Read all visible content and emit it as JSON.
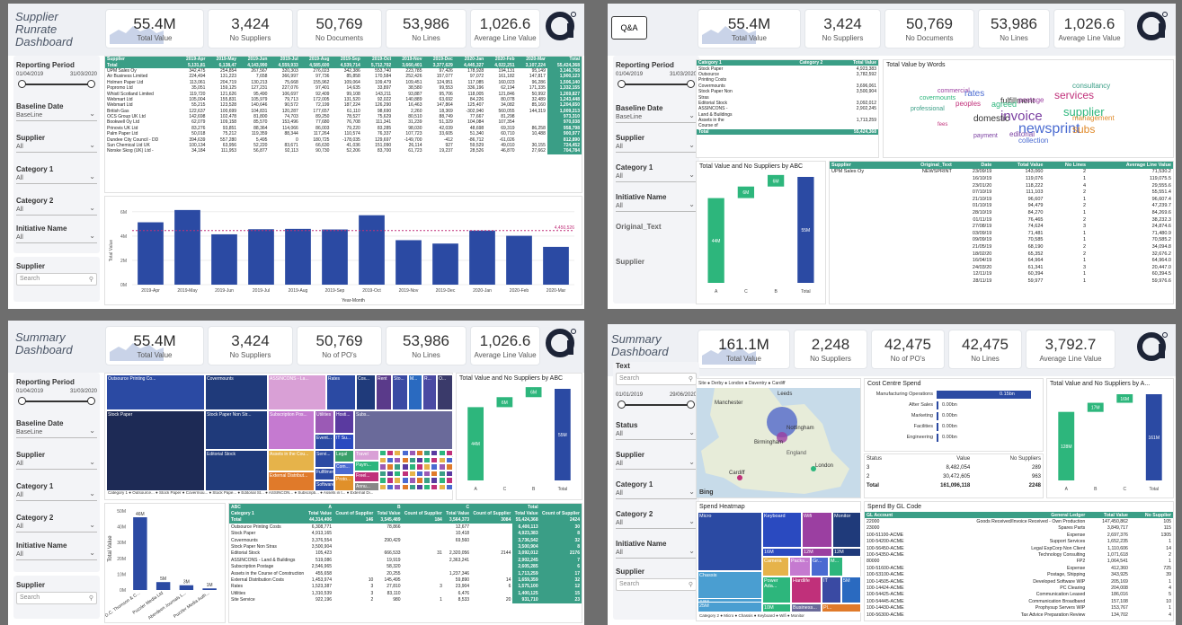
{
  "kpi": {
    "total_value": "55.4M",
    "total_value_label": "Total Value",
    "suppliers": "3,424",
    "suppliers_label": "No Suppliers",
    "documents": "50,769",
    "documents_label": "No Documents",
    "lines": "53,986",
    "lines_label": "No Lines",
    "avg": "1,026.6",
    "avg_label": "Average Line Value",
    "pos_label": "No of PO's"
  },
  "kpi4": {
    "total_value": "161.1M",
    "suppliers": "2,248",
    "pos": "42,475",
    "lines": "42,475",
    "avg": "3,792.7"
  },
  "p1": {
    "title": "Supplier Runrate Dashboard",
    "reporting_label": "Reporting Period",
    "date_from": "01/04/2019",
    "date_to": "31/03/2020",
    "baseline_label": "Baseline Date",
    "baseline_value": "BaseLine",
    "supplier_label": "Supplier",
    "all": "All",
    "cat1": "Category 1",
    "cat2": "Category 2",
    "initiative": "Initiative Name",
    "search": "Search",
    "cols": [
      "Supplier",
      "2019-Apr",
      "2019-May",
      "2019-Jun",
      "2019-Jul",
      "2019-Aug",
      "2019-Sep",
      "2019-Oct",
      "2019-Nov",
      "2019-Dec",
      "2020-Jan",
      "2020-Feb",
      "2020-Mar",
      "Total"
    ],
    "total_row": [
      "Total",
      "5,131,81",
      "6,138,47",
      "4,143,990",
      "4,559,933",
      "4,585,600",
      "4,539,714",
      "5,712,702",
      "3,660,401",
      "3,377,629",
      "4,445,327",
      "4,022,251",
      "3,107,224",
      "55,424,368"
    ],
    "rows": [
      [
        "UPM Sales Oy",
        "342,475",
        "254,854",
        "267,567",
        "320,303",
        "276,023",
        "342,386",
        "553,740",
        "223,785",
        "97,426",
        "178,928",
        "194,131",
        "95,149",
        "3,146,768"
      ],
      [
        "Air Business Limited",
        "224,494",
        "131,223",
        "7,658",
        "366,997",
        "97,736",
        "85,858",
        "170,584",
        "252,426",
        "157,077",
        "97,072",
        "161,182",
        "147,817",
        "1,900,123"
      ],
      [
        "Holmen Paper Ltd",
        "113,061",
        "204,719",
        "130,213",
        "75,668",
        "155,962",
        "109,064",
        "109,479",
        "109,451",
        "124,951",
        "117,085",
        "160,023",
        "96,286",
        "1,506,140"
      ],
      [
        "Popromo Ltd",
        "35,051",
        "159,125",
        "127,231",
        "227,076",
        "97,401",
        "14,635",
        "33,897",
        "38,580",
        "99,553",
        "336,196",
        "62,194",
        "171,335",
        "1,332,155"
      ],
      [
        "Whistl Scotland Limited",
        "119,720",
        "121,626",
        "95,490",
        "106,697",
        "92,409",
        "99,108",
        "143,211",
        "93,887",
        "95,706",
        "118,005",
        "121,846",
        "50,992",
        "1,269,827"
      ],
      [
        "Webmart Ltd",
        "105,004",
        "155,831",
        "105,979",
        "79,713",
        "172,005",
        "131,520",
        "92,022",
        "140,889",
        "63,692",
        "84,226",
        "80,078",
        "32,489",
        "1,243,448"
      ],
      [
        "Webmart Ltd",
        "55,215",
        "123,528",
        "140,646",
        "90,572",
        "72,199",
        "187,224",
        "126,290",
        "16,463",
        "147,864",
        "125,407",
        "34,082",
        "85,160",
        "1,204,650"
      ],
      [
        "British Gas",
        "122,637",
        "100,699",
        "104,831",
        "120,287",
        "177,657",
        "61,110",
        "98,690",
        "2,260",
        "18,369",
        "-302,940",
        "560,055",
        "144,319",
        "1,009,213"
      ],
      [
        "OCS Group UK Ltd",
        "142,698",
        "102,478",
        "81,800",
        "74,703",
        "89,250",
        "78,527",
        "75,629",
        "80,510",
        "88,749",
        "77,667",
        "81,298",
        "",
        "973,310"
      ],
      [
        "Bookwell Oy Ltd",
        "62,079",
        "109,158",
        "85,570",
        "153,496",
        "77,680",
        "76,708",
        "111,341",
        "31,239",
        "51,329",
        "104,084",
        "107,354",
        "",
        "970,038"
      ],
      [
        "Prinovis UK Ltd",
        "83,276",
        "93,851",
        "88,364",
        "114,066",
        "86,003",
        "79,220",
        "83,285",
        "98,030",
        "42,039",
        "48,698",
        "69,319",
        "86,258",
        "958,798"
      ],
      [
        "Palm Paper Ltd",
        "50,018",
        "75,212",
        "119,359",
        "88,344",
        "117,264",
        "110,574",
        "76,337",
        "107,723",
        "33,605",
        "51,340",
        "60,710",
        "10,488",
        "900,977"
      ],
      [
        "Dundee City Council - DD",
        "394,639",
        "557,280",
        "5,495",
        "0",
        "180,725",
        "-178,035",
        "129,697",
        "-149,700",
        "-412",
        "-86,712",
        "-61,026",
        "",
        "812,890"
      ],
      [
        "Sun Chemical Ltd UK",
        "100,134",
        "63,956",
        "52,220",
        "83,671",
        "66,630",
        "41,036",
        "151,090",
        "26,114",
        "927",
        "59,529",
        "49,010",
        "30,155",
        "724,452"
      ],
      [
        "Norske Skog (UK) Ltd -",
        "34,184",
        "111,953",
        "56,877",
        "92,113",
        "90,730",
        "52,206",
        "83,700",
        "61,723",
        "19,237",
        "28,526",
        "46,870",
        "27,662",
        "704,784"
      ]
    ],
    "bar_months": [
      "2019-Apr",
      "2019-May",
      "2019-Jun",
      "2019-Jul",
      "2019-Aug",
      "2019-Sep",
      "2019-Oct",
      "2019-Nov",
      "2019-Dec",
      "2020-Jan",
      "2020-Feb",
      "2020-Mar"
    ],
    "bar_values": [
      5.13,
      6.14,
      4.14,
      4.56,
      4.59,
      4.54,
      5.71,
      3.66,
      3.38,
      4.45,
      4.02,
      3.11
    ],
    "ref_line": "4,450,526",
    "yticks": [
      "6M",
      "4M",
      "2M",
      "0M"
    ],
    "ylabel": "Total Value",
    "xlabel": "Year-Month"
  },
  "p2": {
    "badge": "Q&A",
    "reporting_label": "Reporting Period",
    "date_from": "01/04/2019",
    "date_to": "31/03/2020",
    "baseline_label": "Baseline Date",
    "baseline_value": "BaseLine",
    "supplier_label": "Supplier",
    "all": "All",
    "cat1": "Category 1",
    "initiative": "Initiative Name",
    "original_text": "Original_Text",
    "supplier2": "Supplier",
    "cat_cols": [
      "Category 1",
      "Category 2",
      "Total Value"
    ],
    "cat_rows": [
      [
        "Stock Paper",
        "",
        "4,923,383"
      ],
      [
        "Outsource",
        "",
        "3,782,592"
      ],
      [
        "Printing Costs",
        "",
        ""
      ],
      [
        "Covermounts",
        "",
        "3,696,061"
      ],
      [
        "Stock Paper Non",
        "",
        "3,500,904"
      ],
      [
        "Stras",
        "",
        ""
      ],
      [
        "Editorial Stock",
        "",
        "3,092,012"
      ],
      [
        "ASSINCONS -",
        "",
        "2,902,245"
      ],
      [
        "Land & Buildings",
        "",
        ""
      ],
      [
        "Assets in the",
        "",
        "1,713,259"
      ],
      [
        "Course of",
        "",
        ""
      ]
    ],
    "cat_total": [
      "Total",
      "",
      "55,424,368"
    ],
    "words_title": "Total Value by Words",
    "words": [
      "newsprint",
      "invoice",
      "services",
      "supplier",
      "fulfillment",
      "subs",
      "consultancy",
      "commercial",
      "rates",
      "editorial",
      "peoples",
      "agreed",
      "domestic",
      "management",
      "professional",
      "postage",
      "collection",
      "payment",
      "fees",
      "covermounts"
    ],
    "abc_title": "Total Value and No Suppliers by ABC",
    "abc_labels": [
      "44M",
      "6M",
      "6M",
      "55M"
    ],
    "abc_x": [
      "A",
      "C",
      "B",
      "Total"
    ],
    "detail_cols": [
      "Supplier",
      "Original_Text",
      "Date",
      "Total Value",
      "No Lines",
      "Average Line Value"
    ],
    "detail_supplier": "UPM Sales Oy",
    "detail_text": "NEWSPRINT",
    "detail_rows": [
      [
        "23/09/19",
        "143,060",
        "2",
        "71,530.2"
      ],
      [
        "16/10/19",
        "119,076",
        "1",
        "119,075.5"
      ],
      [
        "23/01/20",
        "118,222",
        "4",
        "29,555.6"
      ],
      [
        "07/10/19",
        "111,103",
        "2",
        "55,551.4"
      ],
      [
        "21/10/19",
        "96,607",
        "1",
        "96,607.4"
      ],
      [
        "01/10/19",
        "94,479",
        "2",
        "47,239.7"
      ],
      [
        "28/10/19",
        "84,270",
        "1",
        "84,269.6"
      ],
      [
        "01/11/19",
        "76,465",
        "2",
        "38,232.3"
      ],
      [
        "27/08/19",
        "74,624",
        "3",
        "24,874.6"
      ],
      [
        "03/09/19",
        "71,481",
        "1",
        "71,480.9"
      ],
      [
        "09/09/19",
        "70,585",
        "1",
        "70,585.2"
      ],
      [
        "21/05/19",
        "68,190",
        "2",
        "34,094.8"
      ],
      [
        "18/02/20",
        "65,352",
        "2",
        "32,676.2"
      ],
      [
        "16/04/19",
        "64,964",
        "1",
        "64,964.0"
      ],
      [
        "24/03/20",
        "61,341",
        "3",
        "20,447.0"
      ],
      [
        "12/11/19",
        "60,394",
        "1",
        "60,394.5"
      ],
      [
        "28/11/19",
        "59,977",
        "1",
        "59,976.6"
      ]
    ]
  },
  "p3": {
    "title": "Summary Dashboard",
    "reporting_label": "Reporting Period",
    "date_from": "01/04/2019",
    "date_to": "31/03/2020",
    "baseline_label": "Baseline Date",
    "baseline_value": "BaseLine",
    "supplier_label": "Supplier",
    "all": "All",
    "cat1": "Category 1",
    "cat2": "Category 2",
    "initiative": "Initiative Name",
    "supplier2": "Supplier",
    "search": "Search",
    "tree": [
      "Outsource Printing Co...",
      "Covermounts",
      "ASSINCONS - La...",
      "Rates",
      "Cos...",
      "Rent",
      "Sto...",
      "M...",
      "R...",
      "O...",
      "Stock Paper Non Str...",
      "Subscription Pos...",
      "Utilities",
      "Hosti...",
      "Event...",
      "IT Su...",
      "Stock Paper",
      "Editorial Stock",
      "Subs...",
      "Legal",
      "Servi...",
      "Assets in the Cou...",
      "Com...",
      "Fulfilmen...",
      "Proto...",
      "External Distribut...",
      "Software ...",
      "Travel",
      "Paym...",
      "Freel...",
      "Annu..."
    ],
    "tree_legend": "Category 1 ● Outsource... ● Stock Paper ● Covermou... ● Stock Pape... ● Editorial St... ● ASSINCON... ● Subscripti... ● Assets in t... ● External Di...",
    "abc_title": "Total Value and No Suppliers by ABC",
    "abc_labels": [
      "44M",
      "6M",
      "6M",
      "55M"
    ],
    "abc_x": [
      "A",
      "C",
      "B",
      "Total"
    ],
    "bars": {
      "labels": [
        "D.C. Thomson & C...",
        "Puzzler Media Ltd",
        "Aberdeen Journals L...",
        "Puzzler Media Auth..."
      ],
      "values": [
        46,
        5,
        3,
        1
      ],
      "vlabels": [
        "46M",
        "5M",
        "3M",
        "1M"
      ],
      "yticks": [
        "50M",
        "40M",
        "30M",
        "20M",
        "10M",
        "0M"
      ],
      "ylabel": "Total Value"
    },
    "mt_head1": [
      "ABC",
      "A",
      "",
      "B",
      "",
      "C",
      "",
      "Total",
      ""
    ],
    "mt_head2": [
      "Category 1",
      "Total Value",
      "Count of Supplier",
      "Total Value",
      "Count of Supplier",
      "Total Value",
      "Count of Supplier",
      "Total Value",
      "Count of Supplier"
    ],
    "mt_total": [
      "Total",
      "44,314,406",
      "146",
      "3,545,489",
      "184",
      "3,564,373",
      "3084",
      "55,424,368",
      "2424"
    ],
    "mt_rows": [
      [
        "Outsource Printing Costs",
        "6,308,771",
        "",
        "78,866",
        "",
        "12,677",
        "",
        "6,400,113",
        "30"
      ],
      [
        "Stock Paper",
        "4,913,165",
        "",
        "",
        "",
        "10,418",
        "",
        "4,923,383",
        "8"
      ],
      [
        "Covermounts",
        "3,376,554",
        "",
        "290,429",
        "",
        "69,560",
        "",
        "3,736,542",
        "32"
      ],
      [
        "Stock Paper Non Stras",
        "3,500,904",
        "",
        "",
        "",
        "",
        "",
        "3,500,904",
        "8"
      ],
      [
        "Editorial Stock",
        "105,423",
        "",
        "666,533",
        "31",
        "2,320,056",
        "2144",
        "3,092,012",
        "2176"
      ],
      [
        "ASSINCONS - Land & Buildings",
        "519,086",
        "",
        "19,919",
        "",
        "2,363,241",
        "",
        "2,902,245",
        "7"
      ],
      [
        "Subscription Postage",
        "2,546,965",
        "",
        "58,320",
        "",
        "",
        "",
        "2,605,285",
        "6"
      ],
      [
        "Assets in the Course of Construction",
        "455,658",
        "",
        "20,255",
        "",
        "1,237,346",
        "",
        "1,713,259",
        "17"
      ],
      [
        "External Distribution Costs",
        "1,453,974",
        "10",
        "145,495",
        "",
        "59,890",
        "14",
        "1,659,359",
        "32"
      ],
      [
        "Rates",
        "1,523,387",
        "3",
        "27,810",
        "3",
        "23,904",
        "6",
        "1,575,100",
        "12"
      ],
      [
        "Utilities",
        "1,310,539",
        "3",
        "83,110",
        "",
        "6,476",
        "",
        "1,400,125",
        "15"
      ],
      [
        "Site Service",
        "922,196",
        "2",
        "980",
        "1",
        "8,533",
        "20",
        "931,710",
        "23"
      ]
    ]
  },
  "p4": {
    "title": "Summary Dashboard",
    "text_label": "Text",
    "search": "Search",
    "date_from": "01/01/2019",
    "date_to": "29/06/2020",
    "status": "Status",
    "all": "All",
    "supplier_label": "Supplier",
    "cat1": "Category 1",
    "cat2": "Category 2",
    "initiative": "Initiative Name",
    "supplier2": "Supplier",
    "map_title": "Site ● Derby ● London ● Daventry ● Cardiff",
    "map_cities": [
      "Manchester",
      "Leeds",
      "Nottingham",
      "Birmingham",
      "Cardiff",
      "London",
      "England"
    ],
    "bing": "Bing",
    "ccs_title": "Cost Centre Spend",
    "ccs_items": [
      "Manufacturing Operations",
      "After Sales",
      "Marketing",
      "Facilities",
      "Engineering"
    ],
    "ccs_vals": [
      "0.15bn",
      "0.00bn",
      "0.00bn",
      "0.00bn",
      "0.00bn"
    ],
    "ccs_frac": [
      1,
      0.02,
      0.01,
      0.01,
      0.01
    ],
    "st_cols": [
      "Status",
      "Value",
      "No Suppliers"
    ],
    "st_rows": [
      [
        "3",
        "8,482,054",
        "289"
      ],
      [
        "2",
        "30,472,605",
        "963"
      ]
    ],
    "st_total": [
      "Total",
      "161,096,118",
      "2248"
    ],
    "abc_title": "Total Value and No Suppliers by A...",
    "abc_labels": [
      "128M",
      "17M",
      "16M",
      "161M"
    ],
    "abc_x": [
      "A",
      "B",
      "C",
      "Total"
    ],
    "heat_title": "Spend Heatmap",
    "heat": [
      "Micro",
      "Keyboard",
      "Wifi",
      "Monitor",
      "16M",
      "12M",
      "12M",
      "Camera",
      "Packs...",
      "Gr...",
      "M...",
      "Chassis",
      "44M",
      "Power Ada...",
      "Hardlife",
      "IT",
      "5M",
      "Business...",
      "25M",
      "10M",
      "Pl..."
    ],
    "heat_legend": "Category 2 ● Micro ● Chassis ● Keyboard ● Wifi ● Monitor",
    "gl_title": "Spend By GL Code",
    "gl_cols": [
      "GL Account",
      "General Ledger",
      "Total Value",
      "No Supplier"
    ],
    "gl_rows": [
      [
        "22000",
        "Goods Received/Invoice Received - Own Production",
        "147,450,862",
        "105"
      ],
      [
        "23000",
        "Spares Parts",
        "3,849,717",
        "115"
      ],
      [
        "100-51100-ACME",
        "Expense",
        "2,697,376",
        "1305"
      ],
      [
        "100-54200-ACME",
        "Support Services",
        "1,652,235",
        "1"
      ],
      [
        "100-56450-ACME",
        "Legal ExpCorp Non Client",
        "1,110,606",
        "14"
      ],
      [
        "100-54350-ACME",
        "Technology Consulting",
        "1,071,618",
        "2"
      ],
      [
        "80000",
        "FP2",
        "1,064,541",
        "1"
      ],
      [
        "100-51600-ACME",
        "Expense",
        "412,360",
        "725"
      ],
      [
        "100-53100-ACME",
        "Postage, Shipping",
        "343,925",
        "39"
      ],
      [
        "100-14505-ACME",
        "Developed Software WIP",
        "205,169",
        "1"
      ],
      [
        "100-14424-ACME",
        "PC Clearing",
        "204,008",
        "4"
      ],
      [
        "100-54425-ACME",
        "Communication Leased",
        "186,016",
        "5"
      ],
      [
        "100-54445-ACME",
        "Communication Broadband",
        "157,108",
        "10"
      ],
      [
        "100-14430-ACME",
        "Prophysup Servers WIP",
        "153,767",
        "1"
      ],
      [
        "100-56300-ACME",
        "Tax Advice Preparation Review",
        "134,702",
        "4"
      ]
    ]
  },
  "colors": {
    "teal": "#3a9e86",
    "navy": "#2b4aa3",
    "green": "#2db67c",
    "accent": "#c0307a"
  }
}
